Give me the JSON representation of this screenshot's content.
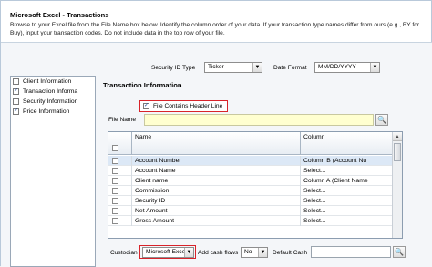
{
  "window": {
    "title": "Microsoft Excel - Transactions",
    "instructions": "Browse to your Excel file from the File Name box below. Identify the column order of your data. If your transaction type names differ from ours (e.g., BY for Buy), input your transaction codes. Do not include data in the top row of your file."
  },
  "options": {
    "security_id_label": "Security ID Type",
    "security_id_value": "Ticker",
    "date_format_label": "Date Format",
    "date_format_value": "MM/DD/YYYY"
  },
  "tree": {
    "items": [
      {
        "label": "Client Information",
        "checked": ""
      },
      {
        "label": "Transaction Informa",
        "checked": "✓"
      },
      {
        "label": "Security Information",
        "checked": ""
      },
      {
        "label": "Price Information",
        "checked": "✓"
      }
    ]
  },
  "section": {
    "title": "Transaction Information",
    "header_line_label": "File Contains Header Line",
    "header_line_checked": "✓",
    "file_name_label": "File Name",
    "file_name_value": ""
  },
  "grid": {
    "columns": [
      "Name",
      "Column"
    ],
    "rows": [
      {
        "name": "Account Number",
        "column": "Column B (Account Nu"
      },
      {
        "name": "Account Name",
        "column": "Select..."
      },
      {
        "name": "Client name",
        "column": "Column A (Client Name"
      },
      {
        "name": "Commission",
        "column": "Select..."
      },
      {
        "name": "Security ID",
        "column": "Select..."
      },
      {
        "name": "Net Amount",
        "column": "Select..."
      },
      {
        "name": "Gross Amount",
        "column": "Select..."
      }
    ]
  },
  "footer": {
    "custodian_label": "Custodian",
    "custodian_value": "Microsoft Exce",
    "add_cash_label": "Add cash flows",
    "add_cash_value": "No",
    "default_cash_label": "Default Cash",
    "default_cash_value": ""
  },
  "icons": {
    "search": "search-icon",
    "dropdown": "chevron-down-icon"
  }
}
